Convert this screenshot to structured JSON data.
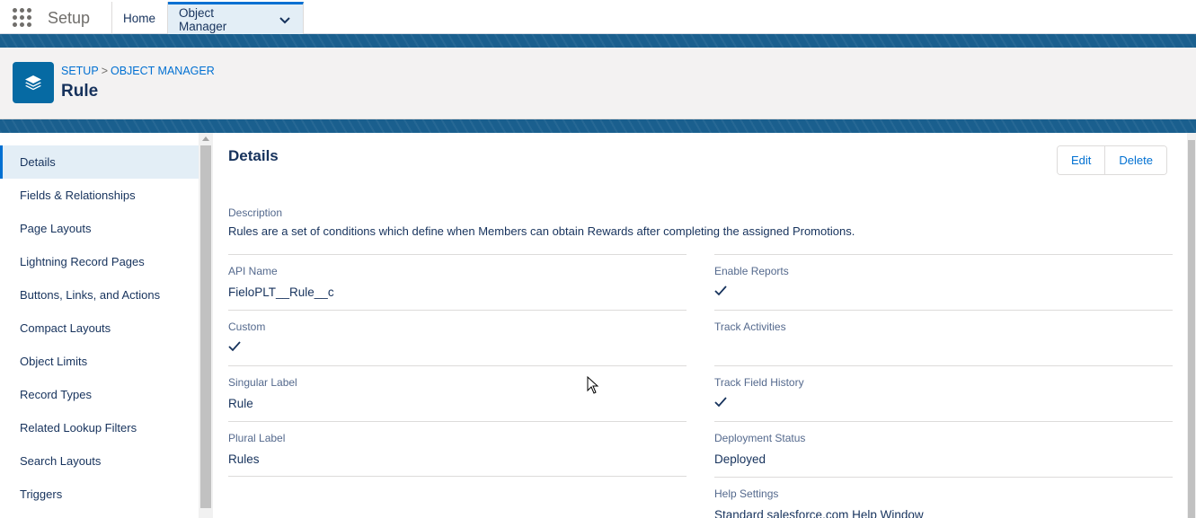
{
  "nav": {
    "app_name": "Setup",
    "tabs": [
      {
        "label": "Home"
      },
      {
        "label": "Object Manager"
      }
    ]
  },
  "header": {
    "breadcrumb": {
      "root": "SETUP",
      "separator": ">",
      "current": "OBJECT MANAGER"
    },
    "title": "Rule",
    "icon": "layers-icon"
  },
  "sidebar": {
    "items": [
      {
        "label": "Details"
      },
      {
        "label": "Fields & Relationships"
      },
      {
        "label": "Page Layouts"
      },
      {
        "label": "Lightning Record Pages"
      },
      {
        "label": "Buttons, Links, and Actions"
      },
      {
        "label": "Compact Layouts"
      },
      {
        "label": "Object Limits"
      },
      {
        "label": "Record Types"
      },
      {
        "label": "Related Lookup Filters"
      },
      {
        "label": "Search Layouts"
      },
      {
        "label": "Triggers"
      }
    ]
  },
  "details": {
    "title": "Details",
    "buttons": {
      "edit": "Edit",
      "delete": "Delete"
    },
    "description": {
      "label": "Description",
      "value": "Rules are a set of conditions which define when Members can obtain Rewards after completing the assigned Promotions."
    },
    "left_fields": [
      {
        "label": "API Name",
        "value": "FieloPLT__Rule__c"
      },
      {
        "label": "Custom",
        "value": ""
      },
      {
        "label": "Singular Label",
        "value": "Rule"
      },
      {
        "label": "Plural Label",
        "value": "Rules"
      }
    ],
    "right_fields": [
      {
        "label": "Enable Reports",
        "value": ""
      },
      {
        "label": "Track Activities",
        "value": ""
      },
      {
        "label": "Track Field History",
        "value": ""
      },
      {
        "label": "Deployment Status",
        "value": "Deployed"
      },
      {
        "label": "Help Settings",
        "value": "Standard salesforce.com Help Window"
      }
    ]
  },
  "colors": {
    "brand_blue": "#0070d2",
    "band_blue": "#1a5f8e",
    "icon_bg": "#066aa3",
    "text": "#16325c"
  }
}
